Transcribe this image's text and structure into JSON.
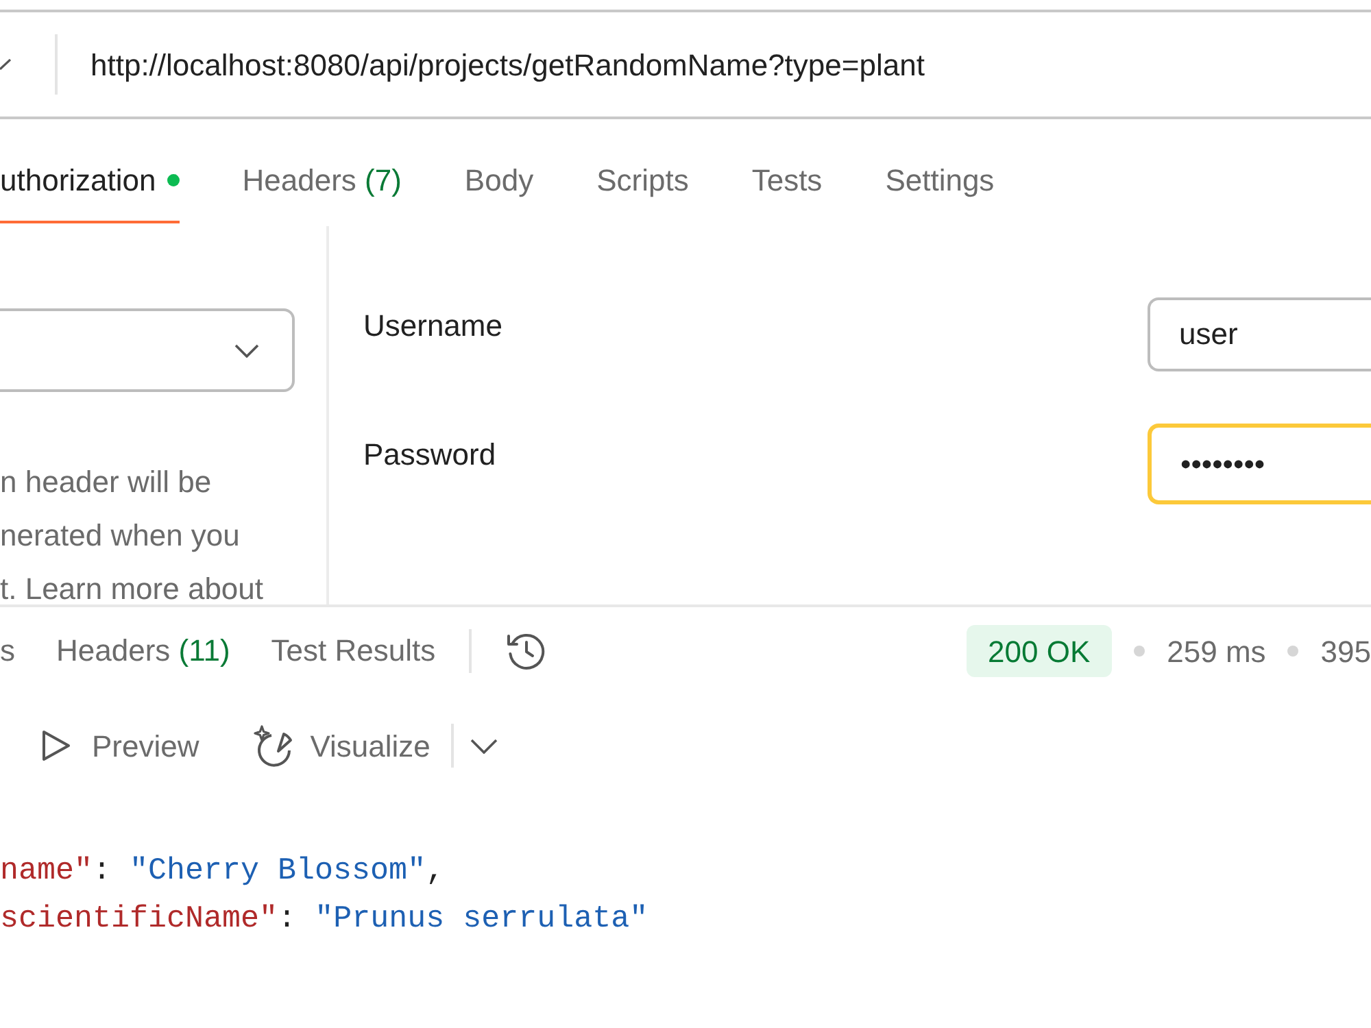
{
  "url_bar": {
    "url": "http://localhost:8080/api/projects/getRandomName?type=plant"
  },
  "request_tabs": [
    {
      "label": "uthorization",
      "indicator": true,
      "selected": true
    },
    {
      "label": "Headers",
      "count": "(7)",
      "indicator": false,
      "selected": false
    },
    {
      "label": "Body",
      "indicator": false,
      "selected": false
    },
    {
      "label": "Scripts",
      "indicator": false,
      "selected": false
    },
    {
      "label": "Tests",
      "indicator": false,
      "selected": false
    },
    {
      "label": "Settings",
      "indicator": false,
      "selected": false
    }
  ],
  "auth_panel": {
    "description_lines": [
      "n header will be",
      "nerated when you",
      "t. Learn more about"
    ]
  },
  "credentials": [
    {
      "label": "Username",
      "value": "user",
      "focused": false
    },
    {
      "label": "Password",
      "value": "••••••••",
      "focused": true
    }
  ],
  "response_tabs": [
    {
      "label": "s",
      "selected": false
    },
    {
      "label": "Headers",
      "count": "(11)",
      "selected": false
    },
    {
      "label": "Test Results",
      "selected": false
    }
  ],
  "response_meta": {
    "status": "200 OK",
    "time": "259 ms",
    "size": "395"
  },
  "view_modes": [
    {
      "label": "Preview",
      "kind": "preview"
    },
    {
      "label": "Visualize",
      "kind": "visualize"
    }
  ],
  "body_lines": [
    {
      "tokens": [
        {
          "kind": "key",
          "text": "name\""
        },
        {
          "kind": "punct",
          "text": ": "
        },
        {
          "kind": "string",
          "text": "\"Cherry Blossom\""
        },
        {
          "kind": "punct",
          "text": ","
        }
      ]
    },
    {
      "tokens": [
        {
          "kind": "key",
          "text": "scientificName\""
        },
        {
          "kind": "punct",
          "text": ": "
        },
        {
          "kind": "string",
          "text": "\"Prunus serrulata\""
        }
      ]
    }
  ]
}
